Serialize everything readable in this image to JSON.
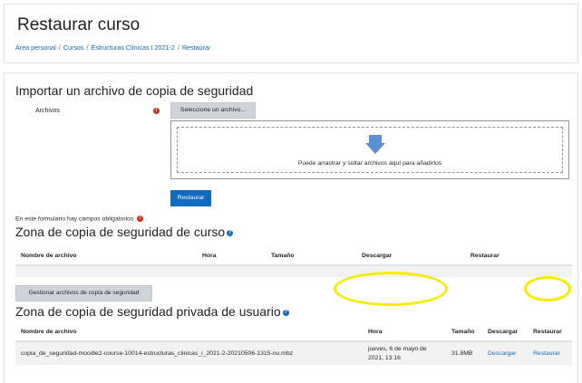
{
  "header": {
    "title": "Restaurar curso",
    "breadcrumb": [
      "Área personal",
      "Cursos",
      "Estructuras Clínicas I 2021-2",
      "Restaurar"
    ]
  },
  "import": {
    "title": "Importar un archivo de copia de seguridad",
    "files_label": "Archivos",
    "choose_button": "Seleccione un archivo...",
    "drop_text": "Puede arrastrar y soltar archivos aquí para añadirlos",
    "restore_button": "Restaurar",
    "required_note": "En este formulario hay campos obligatorios",
    "required_suffix": "."
  },
  "course_zone": {
    "title": "Zona de copia de seguridad de curso",
    "columns": [
      "Nombre de archivo",
      "Hora",
      "Tamaño",
      "Descargar",
      "Restaurar"
    ],
    "manage_button": "Gestionar archivos de copia de seguridad"
  },
  "user_zone": {
    "title": "Zona de copia de seguridad privada de usuario",
    "columns": [
      "Nombre de archivo",
      "Hora",
      "Tamaño",
      "Descargar",
      "Restaurar"
    ],
    "rows": [
      {
        "filename": "copia_de_seguridad-moodle2-course-10014-estructuras_clinicas_i_2021-2-20210506-1315-nu.mbz",
        "time": "jueves, 6 de mayo de 2021, 13:16",
        "size": "31.8MB",
        "download": "Descargar",
        "restore": "Restaurar"
      }
    ]
  },
  "icons": {
    "required": "exclamation-circle-icon",
    "help": "question-circle-icon",
    "drop": "arrow-down-icon"
  },
  "colors": {
    "link": "#0f6cbf",
    "primary": "#0f6cbf",
    "required": "#ca3120",
    "highlight": "#f5ec00",
    "drop_arrow": "#5b8fd1"
  }
}
